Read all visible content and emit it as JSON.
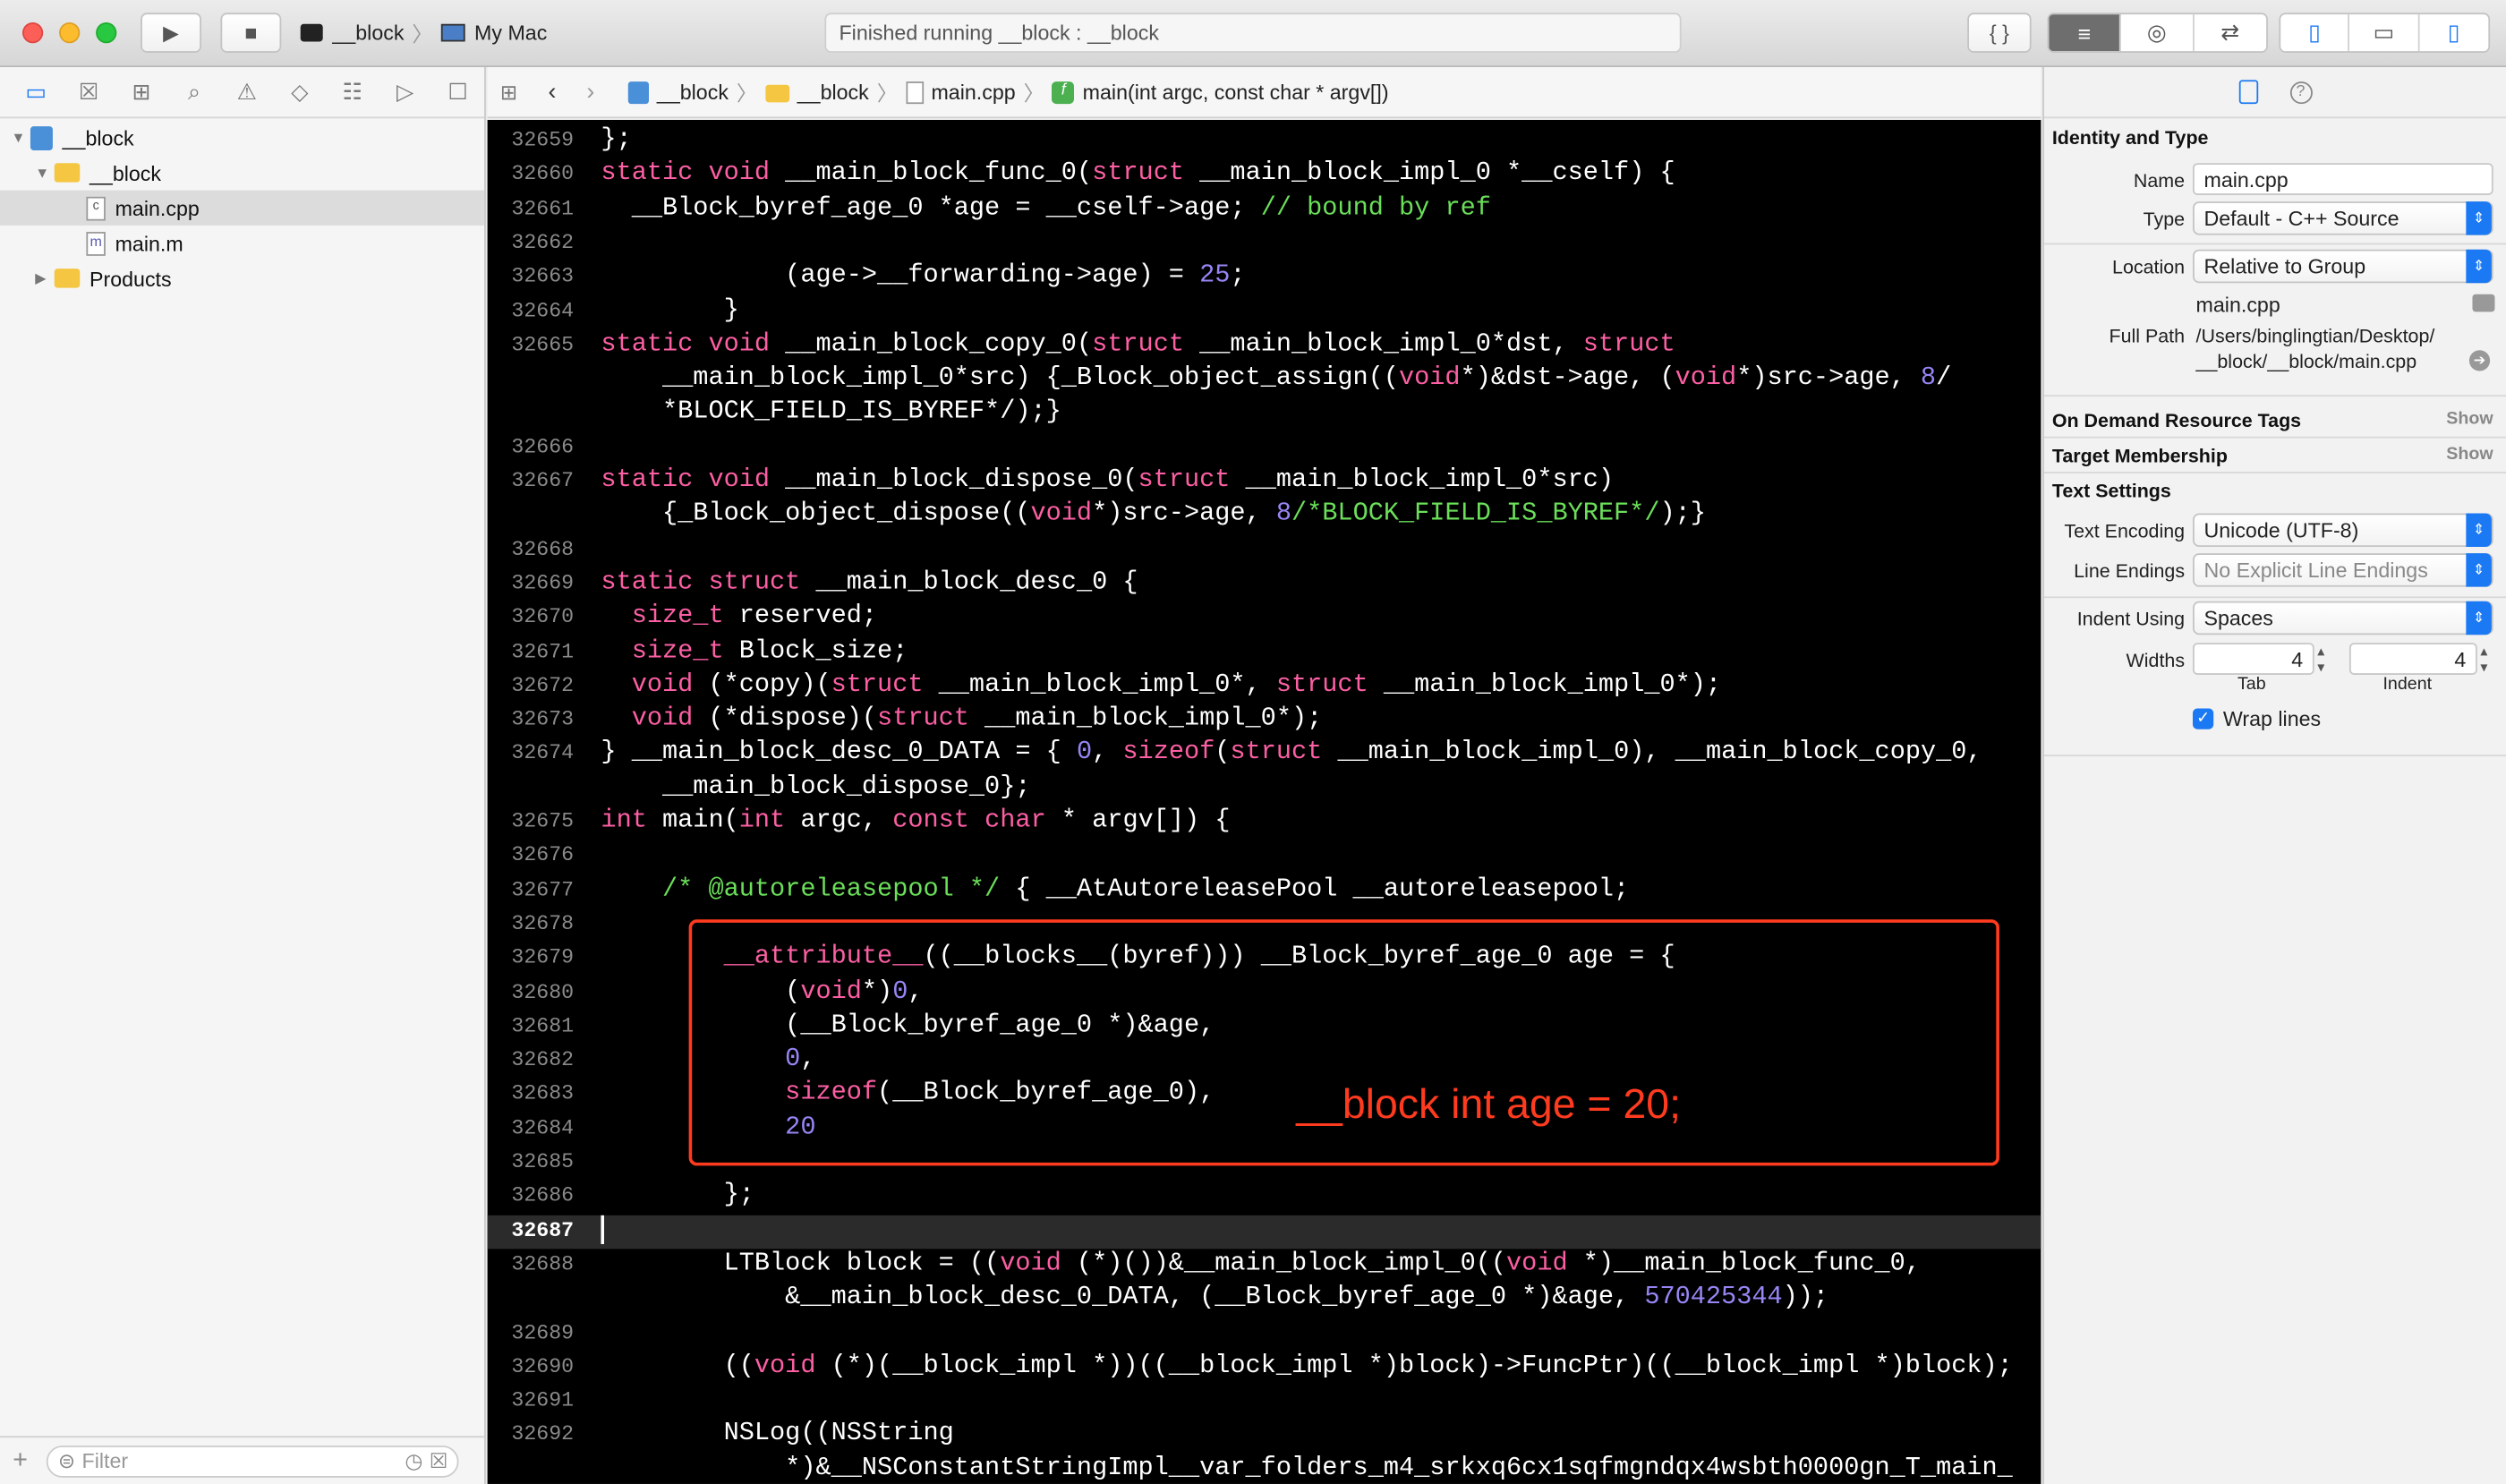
{
  "toolbar": {
    "scheme": "__block",
    "destination": "My Mac",
    "status": "Finished running __block : __block"
  },
  "navigator": {
    "items": [
      {
        "label": "__block",
        "icon": "project-icon"
      },
      {
        "label": "__block",
        "icon": "folder-icon"
      },
      {
        "label": "main.cpp",
        "icon": "cpp-file-icon"
      },
      {
        "label": "main.m",
        "icon": "objc-file-icon"
      },
      {
        "label": "Products",
        "icon": "folder-icon"
      }
    ],
    "filter_placeholder": "Filter"
  },
  "jumpbar": {
    "crumbs": [
      "__block",
      "__block",
      "main.cpp",
      "main(int argc, const char * argv[])"
    ]
  },
  "editor": {
    "lines": [
      {
        "n": "32659",
        "t": "};"
      },
      {
        "n": "32660",
        "t": "static void __main_block_func_0(struct __main_block_impl_0 *__cself) {"
      },
      {
        "n": "32661",
        "t": "  __Block_byref_age_0 *age = __cself->age; // bound by ref"
      },
      {
        "n": "32662",
        "t": ""
      },
      {
        "n": "32663",
        "t": "            (age->__forwarding->age) = 25;"
      },
      {
        "n": "32664",
        "t": "        }"
      },
      {
        "n": "32665",
        "t": "static void __main_block_copy_0(struct __main_block_impl_0*dst, struct"
      },
      {
        "n": "",
        "t": "    __main_block_impl_0*src) {_Block_object_assign((void*)&dst->age, (void*)src->age, 8/"
      },
      {
        "n": "",
        "t": "    *BLOCK_FIELD_IS_BYREF*/);}"
      },
      {
        "n": "32666",
        "t": ""
      },
      {
        "n": "32667",
        "t": "static void __main_block_dispose_0(struct __main_block_impl_0*src)"
      },
      {
        "n": "",
        "t": "    {_Block_object_dispose((void*)src->age, 8/*BLOCK_FIELD_IS_BYREF*/);}"
      },
      {
        "n": "32668",
        "t": ""
      },
      {
        "n": "32669",
        "t": "static struct __main_block_desc_0 {"
      },
      {
        "n": "32670",
        "t": "  size_t reserved;"
      },
      {
        "n": "32671",
        "t": "  size_t Block_size;"
      },
      {
        "n": "32672",
        "t": "  void (*copy)(struct __main_block_impl_0*, struct __main_block_impl_0*);"
      },
      {
        "n": "32673",
        "t": "  void (*dispose)(struct __main_block_impl_0*);"
      },
      {
        "n": "32674",
        "t": "} __main_block_desc_0_DATA = { 0, sizeof(struct __main_block_impl_0), __main_block_copy_0,"
      },
      {
        "n": "",
        "t": "    __main_block_dispose_0};"
      },
      {
        "n": "32675",
        "t": "int main(int argc, const char * argv[]) {"
      },
      {
        "n": "32676",
        "t": ""
      },
      {
        "n": "32677",
        "t": "    /* @autoreleasepool */ { __AtAutoreleasePool __autoreleasepool;"
      },
      {
        "n": "32678",
        "t": ""
      },
      {
        "n": "32679",
        "t": "        __attribute__((__blocks__(byref))) __Block_byref_age_0 age = {"
      },
      {
        "n": "32680",
        "t": "            (void*)0,"
      },
      {
        "n": "32681",
        "t": "            (__Block_byref_age_0 *)&age,"
      },
      {
        "n": "32682",
        "t": "            0,"
      },
      {
        "n": "32683",
        "t": "            sizeof(__Block_byref_age_0),"
      },
      {
        "n": "32684",
        "t": "            20"
      },
      {
        "n": "32685",
        "t": ""
      },
      {
        "n": "32686",
        "t": "        };"
      },
      {
        "n": "32687",
        "t": ""
      },
      {
        "n": "32688",
        "t": "        LTBlock block = ((void (*)())&__main_block_impl_0((void *)__main_block_func_0,"
      },
      {
        "n": "",
        "t": "            &__main_block_desc_0_DATA, (__Block_byref_age_0 *)&age, 570425344));"
      },
      {
        "n": "32689",
        "t": ""
      },
      {
        "n": "32690",
        "t": "        ((void (*)(__block_impl *))((__block_impl *)block)->FuncPtr)((__block_impl *)block);"
      },
      {
        "n": "32691",
        "t": ""
      },
      {
        "n": "32692",
        "t": "        NSLog((NSString"
      },
      {
        "n": "",
        "t": "            *)&__NSConstantStringImpl__var_folders_m4_srkxq6cx1sqfmgndqx4wsbth0000gn_T_main_"
      }
    ],
    "annotation": "__block int age = 20;"
  },
  "inspector": {
    "identity_title": "Identity and Type",
    "name_label": "Name",
    "name_value": "main.cpp",
    "type_label": "Type",
    "type_value": "Default - C++ Source",
    "location_label": "Location",
    "location_value": "Relative to Group",
    "location_file": "main.cpp",
    "fullpath_label": "Full Path",
    "fullpath_line1": "/Users/binglingtian/Desktop/",
    "fullpath_line2": "__block/__block/main.cpp",
    "odr_title": "On Demand Resource Tags",
    "target_title": "Target Membership",
    "show": "Show",
    "text_title": "Text Settings",
    "encoding_label": "Text Encoding",
    "encoding_value": "Unicode (UTF-8)",
    "endings_label": "Line Endings",
    "endings_value": "No Explicit Line Endings",
    "indent_label": "Indent Using",
    "indent_value": "Spaces",
    "widths_label": "Widths",
    "tab_value": "4",
    "indent_width_value": "4",
    "tab_caption": "Tab",
    "indent_caption": "Indent",
    "wrap_label": "Wrap lines"
  },
  "colors": {
    "keyword": "#fc5fa3",
    "number": "#9686f5",
    "comment": "#6bdf5a",
    "highlight": "#ff3b1f",
    "accent": "#1b79f3"
  }
}
